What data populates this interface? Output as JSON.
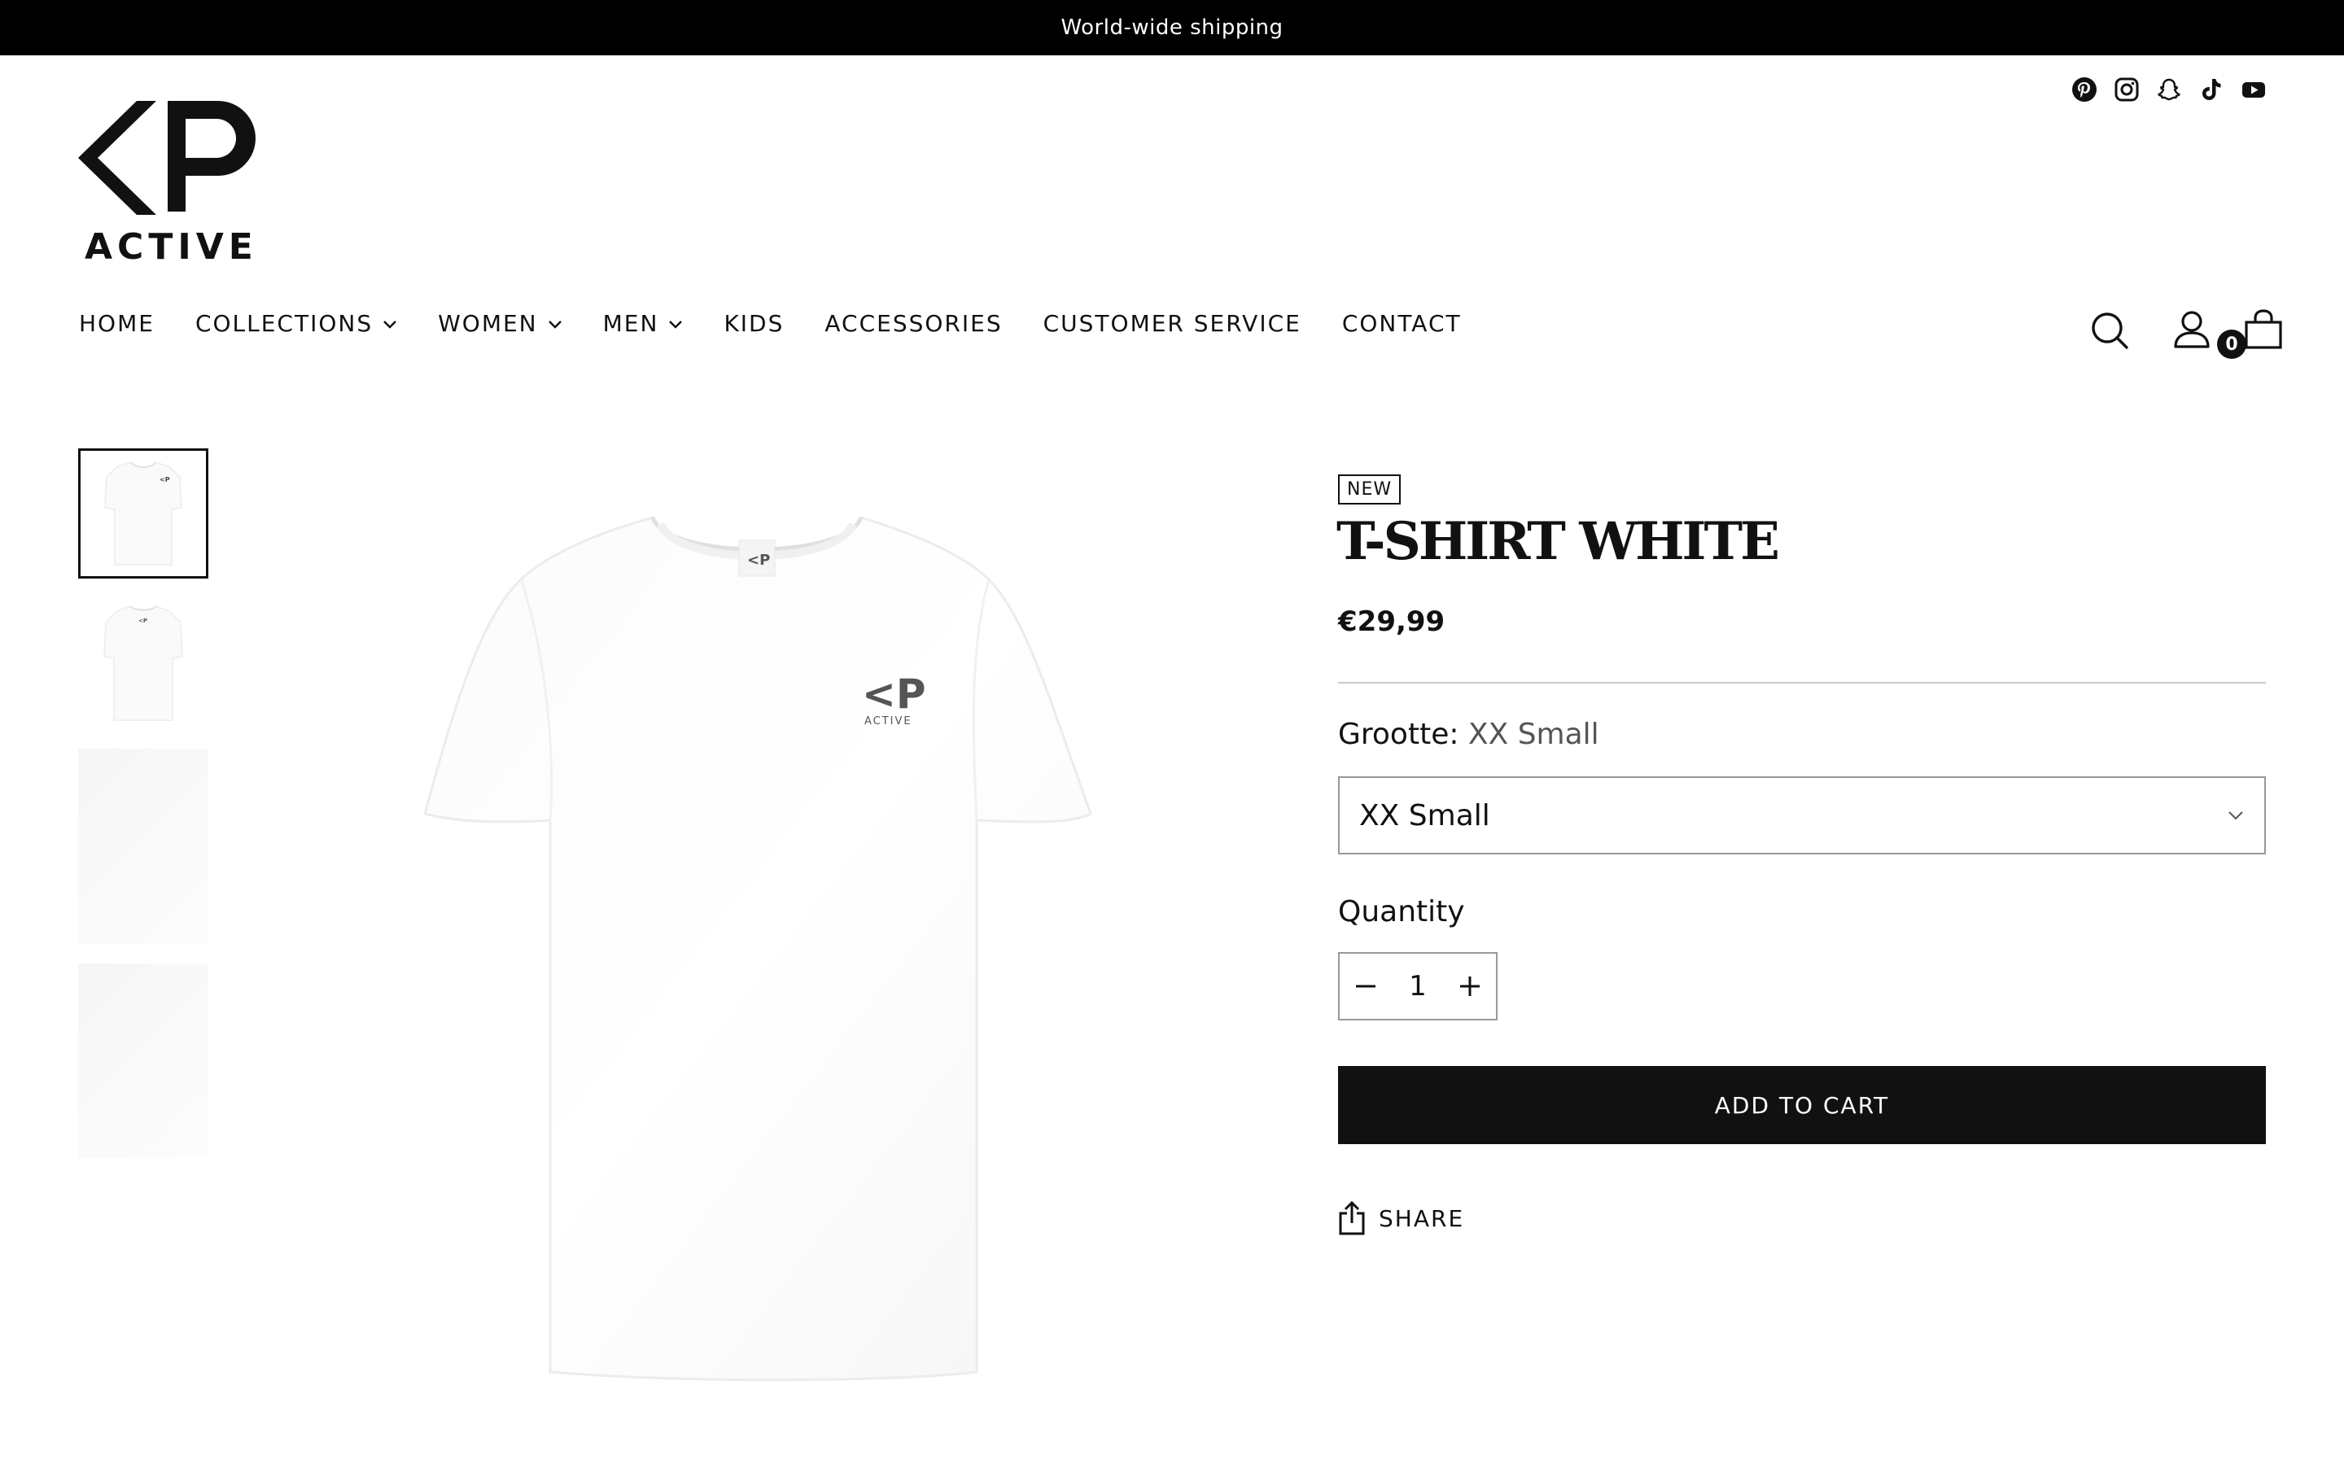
{
  "announcement": {
    "text": "World-wide shipping"
  },
  "brand": {
    "logo_text": "ACTIVE"
  },
  "socials": [
    {
      "icon": "pinterest-icon"
    },
    {
      "icon": "instagram-icon"
    },
    {
      "icon": "snapchat-icon"
    },
    {
      "icon": "tiktok-icon"
    },
    {
      "icon": "youtube-icon"
    }
  ],
  "nav": {
    "items": [
      {
        "label": "HOME",
        "dropdown": false
      },
      {
        "label": "COLLECTIONS",
        "dropdown": true
      },
      {
        "label": "WOMEN",
        "dropdown": true
      },
      {
        "label": "MEN",
        "dropdown": true
      },
      {
        "label": "KIDS",
        "dropdown": false
      },
      {
        "label": "ACCESSORIES",
        "dropdown": false
      },
      {
        "label": "CUSTOMER SERVICE",
        "dropdown": false
      },
      {
        "label": "CONTACT",
        "dropdown": false
      }
    ]
  },
  "header": {
    "cart_count": "0"
  },
  "product": {
    "badge": "NEW",
    "title": "T-SHIRT WHITE",
    "price": "€29,99",
    "size_label": "Grootte:",
    "size_selected": "XX Small",
    "size_select_value": "XX Small",
    "quantity_label": "Quantity",
    "quantity": "1",
    "add_to_cart": "ADD TO CART",
    "share": "SHARE"
  },
  "thumbnails": [
    {
      "kind": "front",
      "active": true
    },
    {
      "kind": "back",
      "active": false
    },
    {
      "kind": "blank",
      "active": false
    },
    {
      "kind": "blank",
      "active": false
    }
  ],
  "colors": {
    "primary": "#111111",
    "announcement_bg": "#000000",
    "muted": "#555555",
    "border": "#999999"
  }
}
